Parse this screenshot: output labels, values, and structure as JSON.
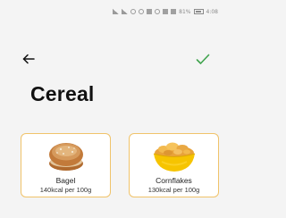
{
  "status_bar": {
    "battery": "81%",
    "time": "4:08"
  },
  "header": {
    "back_icon": "arrow-left-icon",
    "confirm_icon": "checkmark-icon",
    "confirm_color": "#3fa34d"
  },
  "page_title": "Cereal",
  "accent_color": "#f0c36a",
  "foods": [
    {
      "name": "Bagel",
      "kcal": "140kcal per 100g",
      "icon": "bagel-image"
    },
    {
      "name": "Cornflakes",
      "kcal": "130kcal per 100g",
      "icon": "cornflakes-bowl-image"
    }
  ]
}
